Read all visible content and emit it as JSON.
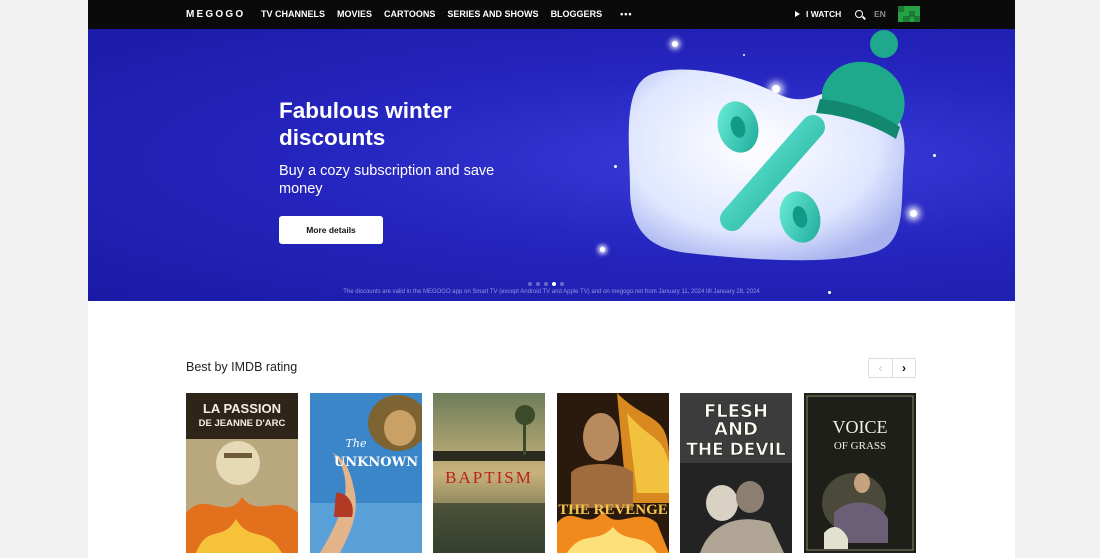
{
  "nav": {
    "logo": "MEGOGO",
    "menu": [
      "TV CHANNELS",
      "MOVIES",
      "CARTOONS",
      "SERIES AND SHOWS",
      "BLOGGERS"
    ],
    "more": "•••",
    "iwatch": "I WATCH",
    "lang": "EN"
  },
  "hero": {
    "title": "Fabulous winter discounts",
    "subtitle": "Buy a cozy subscription and save money",
    "button": "More details",
    "fine_print": "The discounts are valid in the MEGOGO app on Smart TV (except Android TV and Apple TV) and on megogo.net from January 11, 2024 till January 28, 2024",
    "slides_total": 5,
    "slide_active": 4
  },
  "section": {
    "title": "Best by IMDB rating",
    "prev": "‹",
    "next": "›"
  },
  "posters": [
    {
      "title_lines": [
        "LA PASSION",
        "DE JEANNE D'ARC"
      ]
    },
    {
      "title_lines": [
        "The",
        "UNKNOWN"
      ]
    },
    {
      "title_lines": [
        "BAPTISM"
      ]
    },
    {
      "title_lines": [
        "THE REVENGE"
      ]
    },
    {
      "title_lines": [
        "FLESH",
        "AND",
        "THE DEVIL"
      ]
    },
    {
      "title_lines": [
        "VOICE",
        "OF GRASS"
      ]
    }
  ],
  "colors": {
    "nav_bg": "#0a0a0a",
    "hero_bg": "#2626c1",
    "accent": "#2ed3b7",
    "page_bg": "#f1f1f1"
  }
}
